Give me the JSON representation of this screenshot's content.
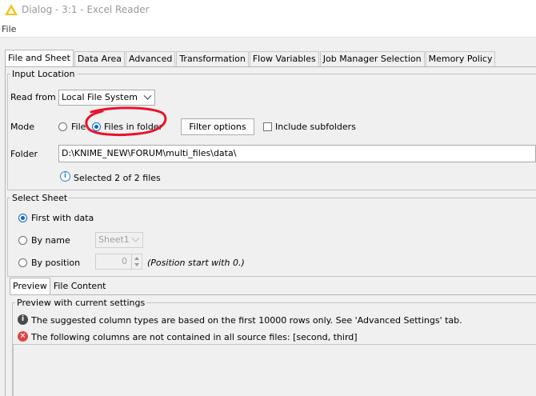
{
  "window": {
    "title": "Dialog - 3:1 - Excel Reader"
  },
  "menubar": {
    "file": "File"
  },
  "tabs": [
    {
      "label": "File and Sheet",
      "active": true
    },
    {
      "label": "Data Area"
    },
    {
      "label": "Advanced"
    },
    {
      "label": "Transformation"
    },
    {
      "label": "Flow Variables"
    },
    {
      "label": "Job Manager Selection"
    },
    {
      "label": "Memory Policy"
    }
  ],
  "input_location": {
    "legend": "Input Location",
    "read_from_label": "Read from",
    "read_from_value": "Local File System",
    "mode_label": "Mode",
    "mode_file": "File",
    "mode_files_in_folder": "Files in folder",
    "filter_options": "Filter options",
    "include_subfolders": "Include subfolders",
    "folder_label": "Folder",
    "folder_value": "D:\\KNIME_NEW\\FORUM\\multi_files\\data\\",
    "selected_info": "Selected 2 of 2 files"
  },
  "select_sheet": {
    "legend": "Select Sheet",
    "first_with_data": "First with data",
    "by_name": "By name",
    "sheet_name": "Sheet1",
    "by_position": "By position",
    "position_value": "0",
    "position_hint": "(Position start with 0.)"
  },
  "bottom_tabs": [
    {
      "label": "Preview",
      "active": true
    },
    {
      "label": "File Content"
    }
  ],
  "preview": {
    "legend": "Preview with current settings",
    "info_message": "The suggested column types are based on the first 10000 rows only. See 'Advanced Settings' tab.",
    "error_message": "The following columns are not contained in all source files: [second, third]"
  },
  "colors": {
    "accent": "#0a68c8",
    "annotation": "#e8132b",
    "error": "#e04646"
  }
}
